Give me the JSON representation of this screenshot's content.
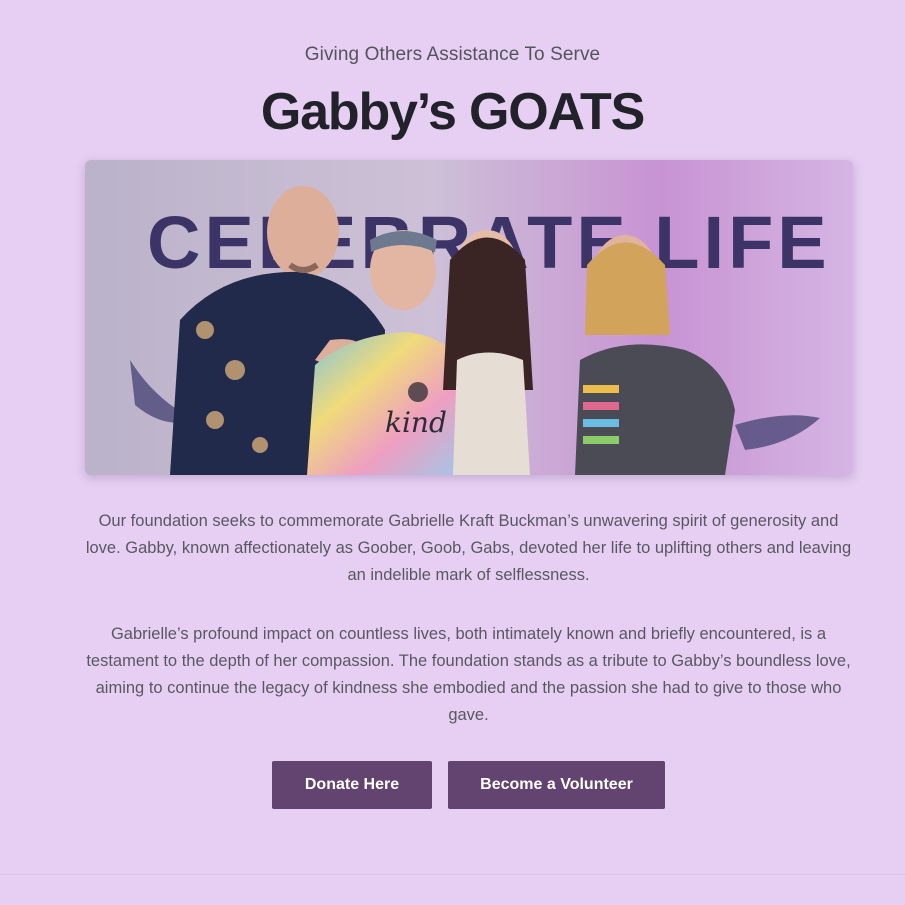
{
  "header": {
    "tagline": "Giving Others Assistance To Serve",
    "title": "Gabby’s GOATS"
  },
  "hero": {
    "banner_text": "CELEBRATE LIFE",
    "shirt_text": "kind",
    "colors": {
      "banner_text": "#3b3566",
      "backdrop_left": "#b8b2c9",
      "backdrop_right": "#c48ad0"
    }
  },
  "body": {
    "paragraph_1": "Our foundation seeks to commemorate Gabrielle Kraft Buckman’s unwavering spirit of generosity and love. Gabby, known affectionately as Goober, Goob, Gabs, devoted her life to uplifting others and leaving an indelible mark of selflessness.",
    "paragraph_2": "Gabrielle’s profound impact on countless lives, both intimately known and briefly encountered, is a testament to the depth of her compassion. The foundation stands as a tribute to Gabby’s boundless love, aiming to continue the legacy of kindness she embodied and the passion she had to give to those who gave."
  },
  "actions": {
    "donate_label": "Donate Here",
    "volunteer_label": "Become a Volunteer"
  },
  "theme": {
    "background": "#e6cff3",
    "button": "#63436f",
    "button_text": "#ffffff"
  }
}
